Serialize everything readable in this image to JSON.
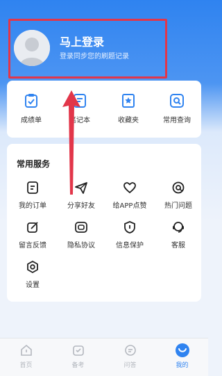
{
  "header": {
    "login_title": "马上登录",
    "login_subtitle": "登录同步您的刷题记录"
  },
  "tools": [
    {
      "label": "成绩单",
      "icon": "report-card-icon"
    },
    {
      "label": "笔记本",
      "icon": "notebook-icon"
    },
    {
      "label": "收藏夹",
      "icon": "favorites-icon"
    },
    {
      "label": "常用查询",
      "icon": "search-query-icon"
    }
  ],
  "services": {
    "title": "常用服务",
    "items": [
      {
        "label": "我的订单",
        "icon": "order-icon"
      },
      {
        "label": "分享好友",
        "icon": "share-icon"
      },
      {
        "label": "给APP点赞",
        "icon": "like-icon"
      },
      {
        "label": "热门问题",
        "icon": "at-icon"
      },
      {
        "label": "留言反馈",
        "icon": "feedback-icon"
      },
      {
        "label": "隐私协议",
        "icon": "privacy-icon"
      },
      {
        "label": "信息保护",
        "icon": "shield-icon"
      },
      {
        "label": "客服",
        "icon": "headset-icon"
      },
      {
        "label": "设置",
        "icon": "settings-icon"
      }
    ]
  },
  "tabbar": {
    "items": [
      {
        "label": "首页",
        "icon": "home-icon",
        "active": false
      },
      {
        "label": "备考",
        "icon": "prep-icon",
        "active": false
      },
      {
        "label": "问答",
        "icon": "qa-icon",
        "active": false
      },
      {
        "label": "我的",
        "icon": "profile-icon",
        "active": true
      }
    ]
  },
  "colors": {
    "accent": "#2f83f0",
    "highlight": "#e2364a",
    "inactive": "#b4b8bf"
  }
}
